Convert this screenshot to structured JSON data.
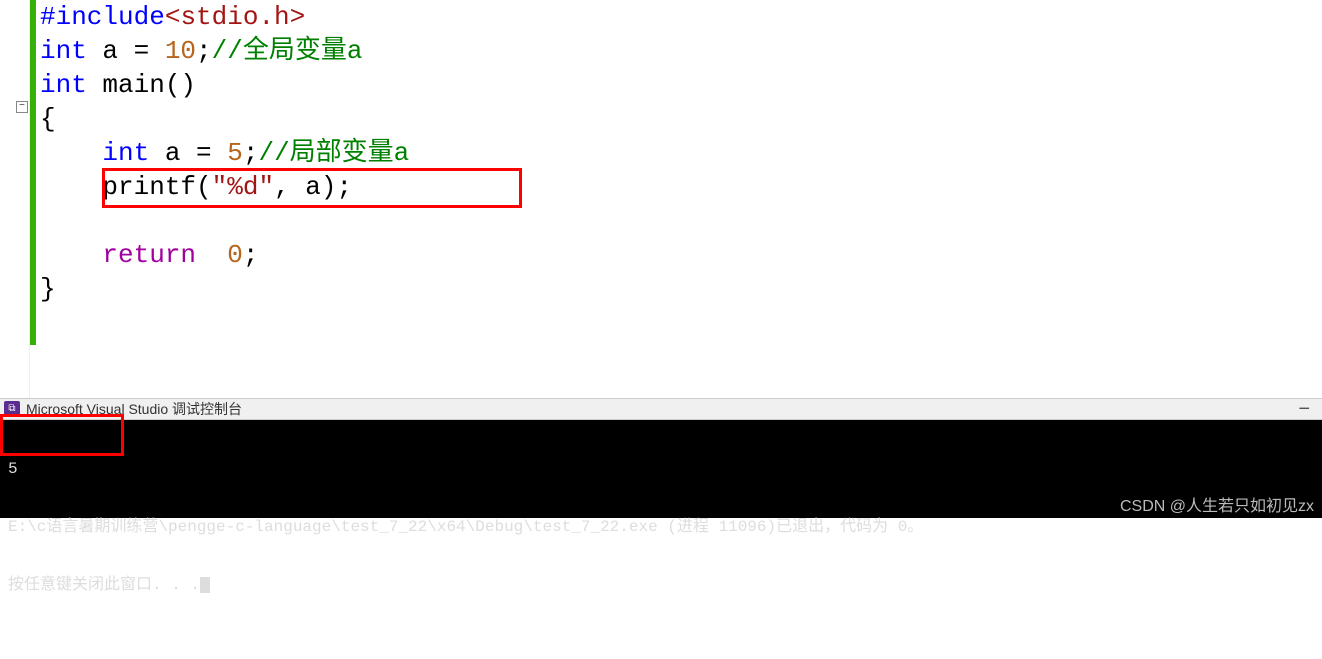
{
  "code": {
    "l1": {
      "kw": "#include",
      "open": "<",
      "hdr": "stdio.h",
      "close": ">"
    },
    "l2": {
      "kw": "int",
      "decl": " a = ",
      "val": "10",
      "semi": ";",
      "cmt": "//全局变量a"
    },
    "l3": {
      "kw": "int",
      "fn": " main",
      "paren": "()"
    },
    "l4": {
      "brace": "{"
    },
    "l5": {
      "indent": "    ",
      "kw": "int",
      "decl": " a = ",
      "val": "5",
      "semi": ";",
      "cmt": "//局部变量a"
    },
    "l6": {
      "indent": "    ",
      "fn": "printf",
      "open": "(",
      "str": "\"%d\"",
      "rest": ", a);"
    },
    "l7": {
      "blank": " "
    },
    "l8": {
      "indent": "    ",
      "kw": "return",
      "sp": "  ",
      "val": "0",
      "semi": ";"
    },
    "l9": {
      "brace": "}"
    }
  },
  "fold": "−",
  "console": {
    "icon": "⧉",
    "title": "Microsoft Visual Studio 调试控制台",
    "minimize": "−",
    "out1": "5",
    "out2": "E:\\c语言暑期训练营\\pengge-c-language\\test_7_22\\x64\\Debug\\test_7_22.exe (进程 11096)已退出，代码为 0。",
    "out3": "按任意键关闭此窗口. . .",
    "watermark": "CSDN @人生若只如初见zx"
  }
}
